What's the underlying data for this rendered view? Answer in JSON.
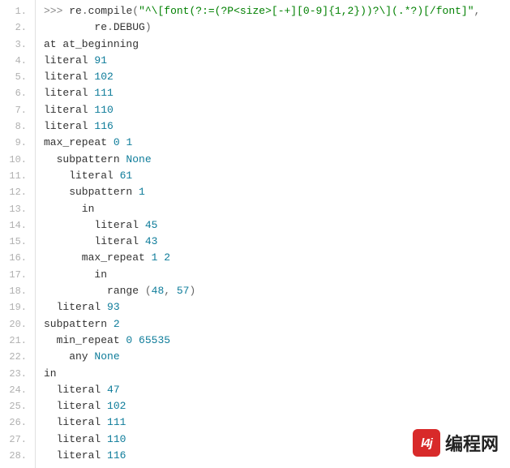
{
  "watermark": {
    "icon_text": "l4j",
    "label": "编程网"
  },
  "lines": [
    {
      "n": "1.",
      "segs": [
        {
          "c": "tok-prompt",
          "t": ">>> "
        },
        {
          "c": "tok-ident",
          "t": "re"
        },
        {
          "c": "tok-punct",
          "t": "."
        },
        {
          "c": "tok-ident",
          "t": "compile"
        },
        {
          "c": "tok-punct",
          "t": "("
        },
        {
          "c": "tok-str",
          "t": "\"^\\[font(?:=(?P<size>[-+][0-9]{1,2}))?\\](.*?)[/font]\""
        },
        {
          "c": "tok-punct",
          "t": ","
        }
      ]
    },
    {
      "n": "2.",
      "segs": [
        {
          "c": "tok-ident",
          "t": "        re"
        },
        {
          "c": "tok-punct",
          "t": "."
        },
        {
          "c": "tok-ident",
          "t": "DEBUG"
        },
        {
          "c": "tok-punct",
          "t": ")"
        }
      ]
    },
    {
      "n": "3.",
      "segs": [
        {
          "c": "tok-ident",
          "t": "at at_beginning"
        }
      ]
    },
    {
      "n": "4.",
      "segs": [
        {
          "c": "tok-ident",
          "t": "literal "
        },
        {
          "c": "tok-num",
          "t": "91"
        }
      ]
    },
    {
      "n": "5.",
      "segs": [
        {
          "c": "tok-ident",
          "t": "literal "
        },
        {
          "c": "tok-num",
          "t": "102"
        }
      ]
    },
    {
      "n": "6.",
      "segs": [
        {
          "c": "tok-ident",
          "t": "literal "
        },
        {
          "c": "tok-num",
          "t": "111"
        }
      ]
    },
    {
      "n": "7.",
      "segs": [
        {
          "c": "tok-ident",
          "t": "literal "
        },
        {
          "c": "tok-num",
          "t": "110"
        }
      ]
    },
    {
      "n": "8.",
      "segs": [
        {
          "c": "tok-ident",
          "t": "literal "
        },
        {
          "c": "tok-num",
          "t": "116"
        }
      ]
    },
    {
      "n": "9.",
      "segs": [
        {
          "c": "tok-ident",
          "t": "max_repeat "
        },
        {
          "c": "tok-num",
          "t": "0"
        },
        {
          "c": "tok-ident",
          "t": " "
        },
        {
          "c": "tok-num",
          "t": "1"
        }
      ]
    },
    {
      "n": "10.",
      "segs": [
        {
          "c": "tok-ident",
          "t": "  subpattern "
        },
        {
          "c": "tok-builtin",
          "t": "None"
        }
      ]
    },
    {
      "n": "11.",
      "segs": [
        {
          "c": "tok-ident",
          "t": "    literal "
        },
        {
          "c": "tok-num",
          "t": "61"
        }
      ]
    },
    {
      "n": "12.",
      "segs": [
        {
          "c": "tok-ident",
          "t": "    subpattern "
        },
        {
          "c": "tok-num",
          "t": "1"
        }
      ]
    },
    {
      "n": "13.",
      "segs": [
        {
          "c": "tok-ident",
          "t": "      in"
        }
      ]
    },
    {
      "n": "14.",
      "segs": [
        {
          "c": "tok-ident",
          "t": "        literal "
        },
        {
          "c": "tok-num",
          "t": "45"
        }
      ]
    },
    {
      "n": "15.",
      "segs": [
        {
          "c": "tok-ident",
          "t": "        literal "
        },
        {
          "c": "tok-num",
          "t": "43"
        }
      ]
    },
    {
      "n": "16.",
      "segs": [
        {
          "c": "tok-ident",
          "t": "      max_repeat "
        },
        {
          "c": "tok-num",
          "t": "1"
        },
        {
          "c": "tok-ident",
          "t": " "
        },
        {
          "c": "tok-num",
          "t": "2"
        }
      ]
    },
    {
      "n": "17.",
      "segs": [
        {
          "c": "tok-ident",
          "t": "        in"
        }
      ]
    },
    {
      "n": "18.",
      "segs": [
        {
          "c": "tok-ident",
          "t": "          range "
        },
        {
          "c": "tok-punct",
          "t": "("
        },
        {
          "c": "tok-num",
          "t": "48"
        },
        {
          "c": "tok-punct",
          "t": ", "
        },
        {
          "c": "tok-num",
          "t": "57"
        },
        {
          "c": "tok-punct",
          "t": ")"
        }
      ]
    },
    {
      "n": "19.",
      "segs": [
        {
          "c": "tok-ident",
          "t": "  literal "
        },
        {
          "c": "tok-num",
          "t": "93"
        }
      ]
    },
    {
      "n": "20.",
      "segs": [
        {
          "c": "tok-ident",
          "t": "subpattern "
        },
        {
          "c": "tok-num",
          "t": "2"
        }
      ]
    },
    {
      "n": "21.",
      "segs": [
        {
          "c": "tok-ident",
          "t": "  min_repeat "
        },
        {
          "c": "tok-num",
          "t": "0"
        },
        {
          "c": "tok-ident",
          "t": " "
        },
        {
          "c": "tok-num",
          "t": "65535"
        }
      ]
    },
    {
      "n": "22.",
      "segs": [
        {
          "c": "tok-ident",
          "t": "    any "
        },
        {
          "c": "tok-builtin",
          "t": "None"
        }
      ]
    },
    {
      "n": "23.",
      "segs": [
        {
          "c": "tok-ident",
          "t": "in"
        }
      ]
    },
    {
      "n": "24.",
      "segs": [
        {
          "c": "tok-ident",
          "t": "  literal "
        },
        {
          "c": "tok-num",
          "t": "47"
        }
      ]
    },
    {
      "n": "25.",
      "segs": [
        {
          "c": "tok-ident",
          "t": "  literal "
        },
        {
          "c": "tok-num",
          "t": "102"
        }
      ]
    },
    {
      "n": "26.",
      "segs": [
        {
          "c": "tok-ident",
          "t": "  literal "
        },
        {
          "c": "tok-num",
          "t": "111"
        }
      ]
    },
    {
      "n": "27.",
      "segs": [
        {
          "c": "tok-ident",
          "t": "  literal "
        },
        {
          "c": "tok-num",
          "t": "110"
        }
      ]
    },
    {
      "n": "28.",
      "segs": [
        {
          "c": "tok-ident",
          "t": "  literal "
        },
        {
          "c": "tok-num",
          "t": "116"
        }
      ]
    }
  ]
}
